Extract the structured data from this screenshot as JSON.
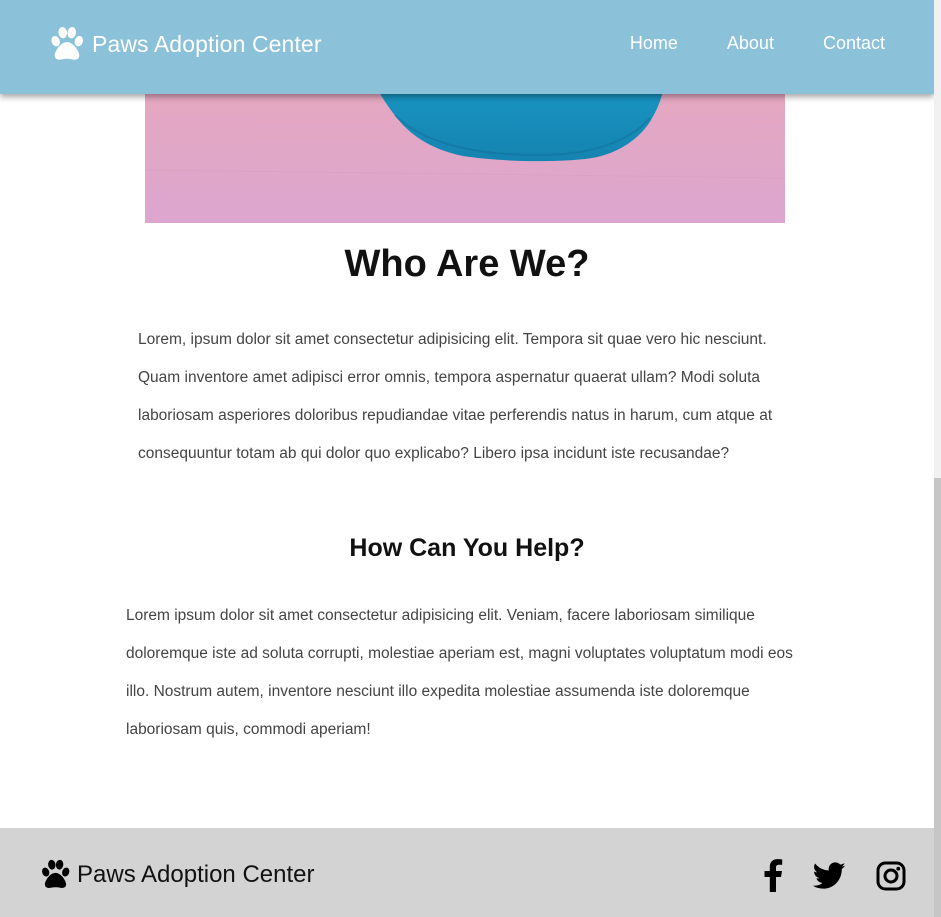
{
  "brand": {
    "name": "Paws Adoption Center",
    "logo_icon": "paw-icon"
  },
  "nav": {
    "items": [
      {
        "label": "Home"
      },
      {
        "label": "About"
      },
      {
        "label": "Contact"
      }
    ]
  },
  "about": {
    "title": "Who Are We?",
    "body": "Lorem, ipsum dolor sit amet consectetur adipisicing elit. Tempora sit quae vero hic nesciunt. Quam inventore amet adipisci error omnis, tempora aspernatur quaerat ullam? Modi soluta laboriosam asperiores doloribus repudiandae vitae perferendis natus in harum, cum atque at consequuntur totam ab qui dolor quo explicabo? Libero ipsa incidunt iste recusandae?"
  },
  "help": {
    "title": "How Can You Help?",
    "body": "Lorem ipsum dolor sit amet consectetur adipisicing elit. Veniam, facere laboriosam similique doloremque iste ad soluta corrupti, molestiae aperiam est, magni voluptates voluptatum modi eos illo. Nostrum autem, inventore nesciunt illo expedita molestiae assumenda iste doloremque laboriosam quis, commodi aperiam!"
  },
  "footer": {
    "brand_name": "Paws Adoption Center",
    "social_icons": [
      "facebook-icon",
      "twitter-icon",
      "instagram-icon"
    ]
  },
  "colors": {
    "navbar": "#8bc1d9",
    "footer": "#d3d3d3",
    "heading": "#111111",
    "body_text": "#444444"
  }
}
